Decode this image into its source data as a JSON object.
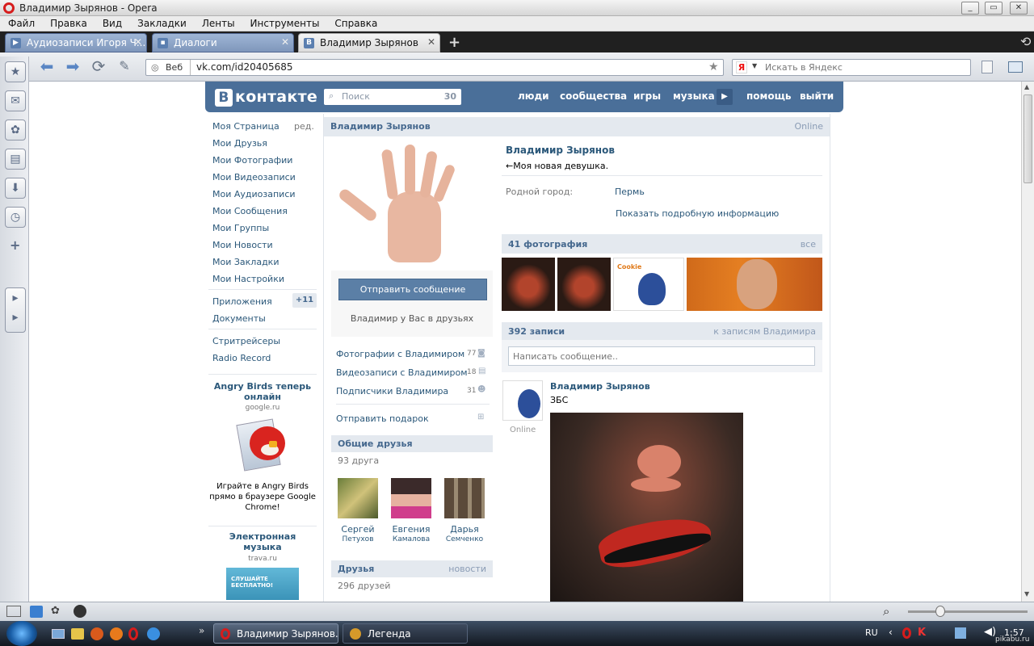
{
  "window": {
    "title": "Владимир Зырянов - Opera"
  },
  "menu": [
    "Файл",
    "Правка",
    "Вид",
    "Закладки",
    "Ленты",
    "Инструменты",
    "Справка"
  ],
  "tabs": [
    {
      "label": "Аудиозаписи Игоря Ч..."
    },
    {
      "label": "Диалоги"
    },
    {
      "label": "Владимир Зырянов"
    }
  ],
  "address": {
    "site_label": "Веб",
    "url": "vk.com/id20405685",
    "search_placeholder": "Искать в Яндекс",
    "search_engine": "Я"
  },
  "vk": {
    "logo_text": "контакте",
    "logo_letter": "В",
    "search_placeholder": "Поиск",
    "search_count": "30",
    "nav": [
      "люди",
      "сообщества",
      "игры",
      "музыка",
      "помощь",
      "выйти"
    ]
  },
  "left_menu": {
    "items": [
      "Моя Страница",
      "Мои Друзья",
      "Мои Фотографии",
      "Мои Видеозаписи",
      "Мои Аудиозаписи",
      "Мои Сообщения",
      "Мои Группы",
      "Мои Новости",
      "Мои Закладки",
      "Мои Настройки"
    ],
    "edit": "ред.",
    "apps": "Приложения",
    "apps_badge": "+11",
    "docs": "Документы",
    "extra": [
      "Стритрейсеры",
      "Radio Record"
    ]
  },
  "ads": [
    {
      "title": "Angry Birds теперь онлайн",
      "domain": "google.ru",
      "text": "Играйте в Angry Birds прямо в браузере Google Chrome!"
    },
    {
      "title": "Электронная музыка",
      "domain": "trava.ru",
      "banner": "СЛУШАЙТЕ БЕСПЛАТНО!"
    }
  ],
  "profile": {
    "name": "Владимир Зырянов",
    "status_online": "Online",
    "status_text": "←Моя новая девушка.",
    "hometown_label": "Родной город:",
    "hometown": "Пермь",
    "show_more": "Показать подробную информацию",
    "send_message": "Отправить сообщение",
    "friend_status": "Владимир у Вас в друзьях",
    "links": [
      {
        "label": "Фотографии с Владимиром",
        "count": "77"
      },
      {
        "label": "Видеозаписи с Владимиром",
        "count": "18"
      },
      {
        "label": "Подписчики Владимира",
        "count": "31"
      }
    ],
    "gift": "Отправить подарок",
    "common_friends": {
      "title": "Общие друзья",
      "count": "93 друга",
      "people": [
        {
          "first": "Сергей",
          "last": "Петухов"
        },
        {
          "first": "Евгения",
          "last": "Камалова"
        },
        {
          "first": "Дарья",
          "last": "Семченко"
        }
      ]
    },
    "friends": {
      "title": "Друзья",
      "link": "новости",
      "count": "296 друзей"
    },
    "photos": {
      "title": "41 фотография",
      "link": "все"
    },
    "wall": {
      "title": "392 записи",
      "link": "к записям Владимира",
      "input_placeholder": "Написать сообщение.."
    },
    "post": {
      "author": "Владимир Зырянов",
      "text": "ЗБС",
      "online": "Online"
    }
  },
  "taskbar": {
    "items": [
      {
        "label": "Владимир Зырянов..."
      },
      {
        "label": "Легенда"
      }
    ],
    "lang": "RU",
    "time": "1:57"
  },
  "watermark": "pikabu.ru",
  "colors": {
    "vk_blue": "#4a6f99",
    "link": "#2b587a",
    "header_bg": "#e4e9ef",
    "button": "#5b7fa6"
  }
}
